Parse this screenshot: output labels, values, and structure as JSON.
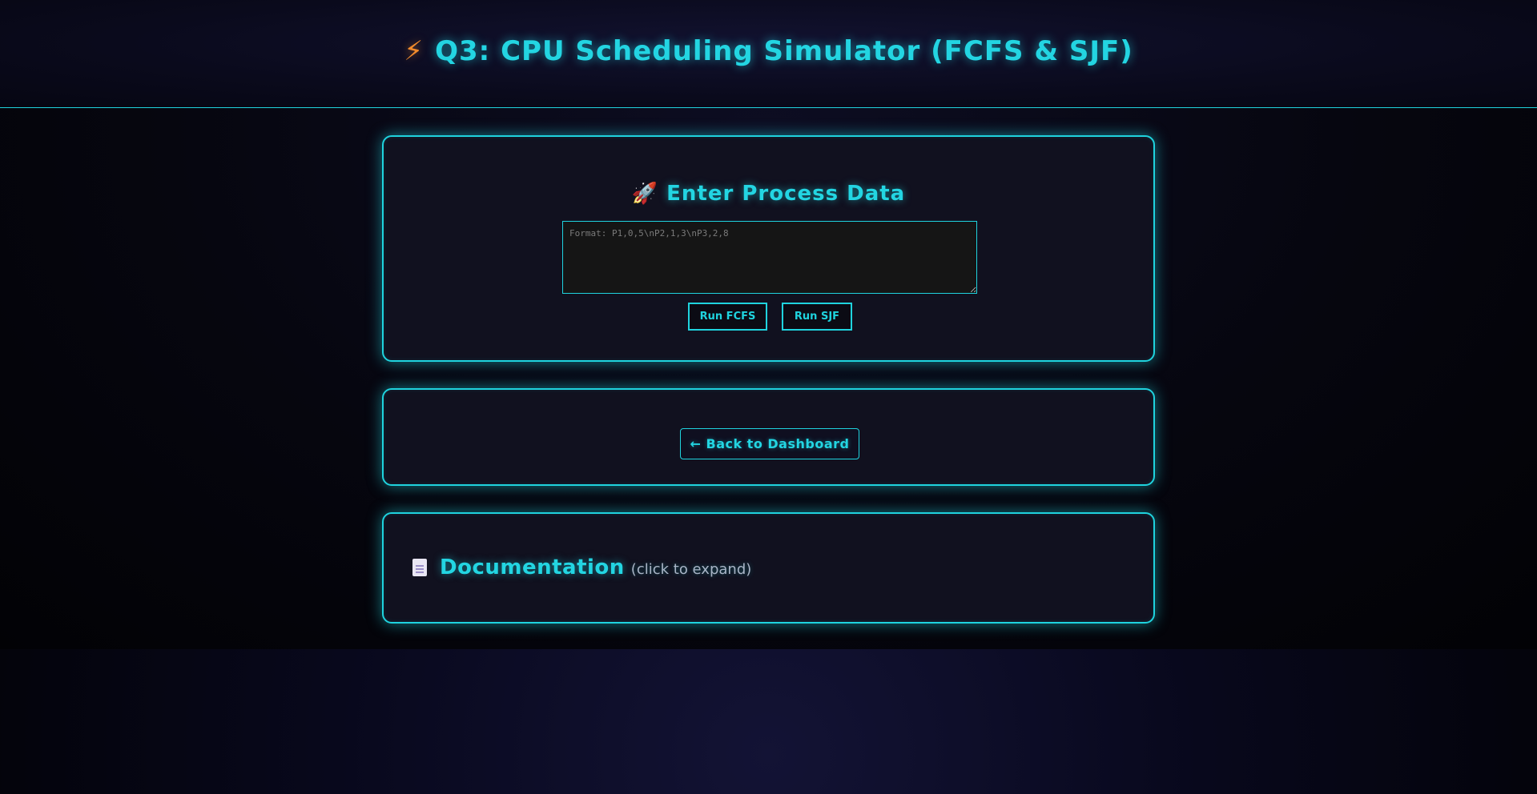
{
  "header": {
    "title_icon": "lightning-bolt-icon",
    "title_icon_glyph": "⚡",
    "title": "Q3: CPU Scheduling Simulator (FCFS & SJF)"
  },
  "input_card": {
    "heading_icon": "rocket-icon",
    "heading_icon_glyph": "🚀",
    "heading": "Enter Process Data",
    "textarea_value": "",
    "textarea_placeholder": "Format: P1,0,5\\nP2,1,3\\nP3,2,8",
    "run_fcfs_label": "Run FCFS",
    "run_sjf_label": "Run SJF"
  },
  "nav_card": {
    "back_label": "← Back to Dashboard"
  },
  "docs_card": {
    "icon": "document-icon",
    "title": "Documentation",
    "hint": "(click to expand)"
  },
  "colors": {
    "accent": "#1fd3de",
    "bolt": "#f08a2c",
    "card_bg": "#11111f",
    "textarea_bg": "#151515"
  }
}
